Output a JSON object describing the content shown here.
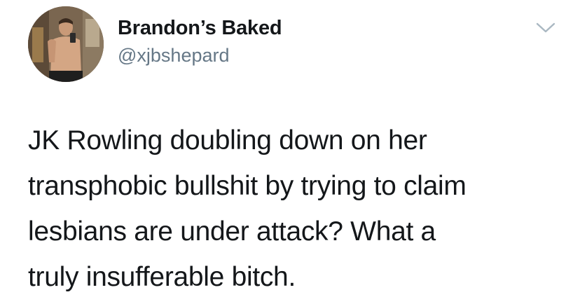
{
  "user": {
    "display_name": "Brandon’s Baked",
    "handle": "@xjbshepard",
    "avatar_icon": "profile-photo"
  },
  "menu": {
    "icon": "chevron-down-icon",
    "color": "#aab8c2"
  },
  "tweet": {
    "lines": [
      "JK Rowling doubling down on her",
      "transphobic bullshit by trying to claim",
      "lesbians are under attack? What a",
      "truly insufferable bitch."
    ]
  },
  "colors": {
    "text": "#14171a",
    "secondary": "#657786"
  }
}
